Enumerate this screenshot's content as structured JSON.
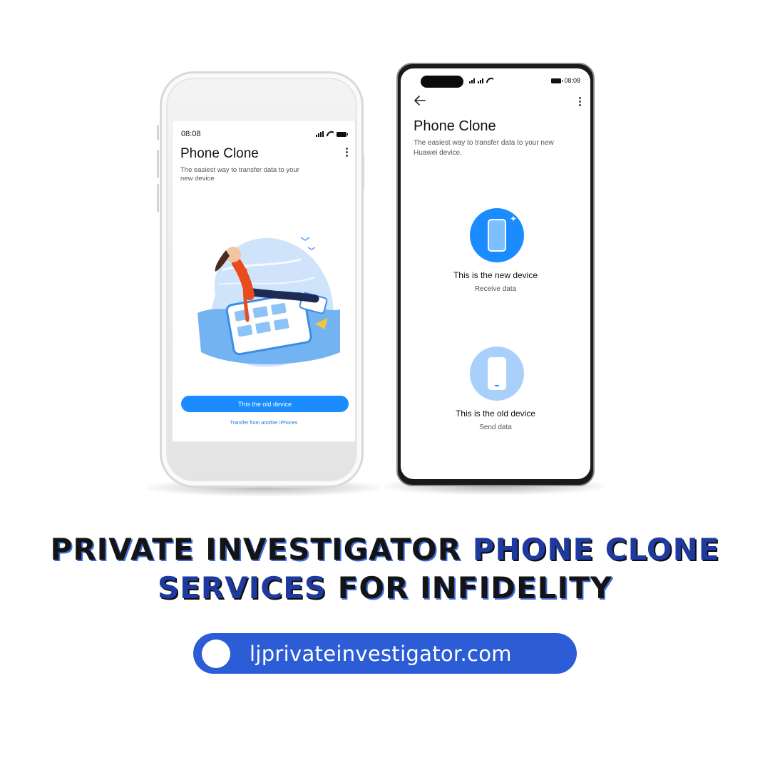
{
  "left_phone": {
    "status_time": "08:08",
    "app_title": "Phone Clone",
    "subtitle": "The easiest way to transfer data to your new device",
    "old_device_button": "This the old device",
    "transfer_link": "Transfer from another iPhones"
  },
  "right_phone": {
    "status_time": "08:08",
    "app_title": "Phone Clone",
    "subtitle": "The easiest way to transfer data to your new Huawei device.",
    "new_device": {
      "title": "This is the new device",
      "subtitle": "Receive data"
    },
    "old_device": {
      "title": "This is the old device",
      "subtitle": "Send data"
    }
  },
  "headline": {
    "part1": "PRIVATE INVESTIGATOR ",
    "highlight": "PHONE CLONE SERVICES",
    "part2": " FOR INFIDELITY"
  },
  "website": "ljprivateinvestigator.com",
  "colors": {
    "accent_blue": "#1a8cff",
    "headline_highlight": "#1e3a9e",
    "pill_blue": "#2c5dd6"
  }
}
